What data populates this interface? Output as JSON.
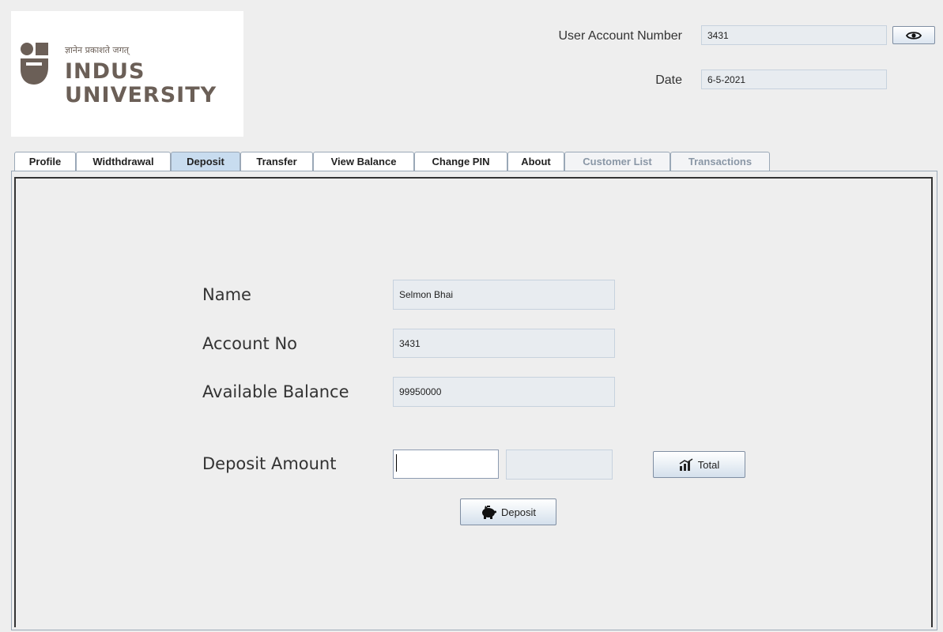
{
  "window": {
    "logo": {
      "tagline": "ज्ञानेन प्रकाशते जगत्",
      "word1": "INDUS",
      "word2": "UNIVERSITY"
    },
    "header": {
      "account_label": "User Account Number",
      "account_value": "3431",
      "date_label": "Date",
      "date_value": "6-5-2021",
      "reveal_icon": "eye-icon"
    },
    "tabs": [
      {
        "label": "Profile",
        "state": "normal"
      },
      {
        "label": "Widthdrawal",
        "state": "normal"
      },
      {
        "label": "Deposit",
        "state": "active"
      },
      {
        "label": "Transfer",
        "state": "normal"
      },
      {
        "label": "View Balance",
        "state": "normal"
      },
      {
        "label": "Change PIN",
        "state": "normal"
      },
      {
        "label": "About",
        "state": "normal"
      },
      {
        "label": "Customer List",
        "state": "disabled"
      },
      {
        "label": "Transactions",
        "state": "disabled"
      }
    ],
    "deposit": {
      "name_label": "Name",
      "name_value": "Selmon Bhai",
      "account_label": "Account No",
      "account_value": "3431",
      "balance_label": "Available Balance",
      "balance_value": "99950000",
      "amount_label": "Deposit Amount",
      "amount_value": "",
      "total_value": "",
      "total_button": "Total",
      "total_icon": "chart-icon",
      "deposit_button": "Deposit",
      "deposit_icon": "piggy-bank-icon"
    },
    "colors": {
      "brand": "#6b5f57",
      "active_tab": "#c8dcef",
      "field_bg": "#e8ecf0"
    }
  }
}
